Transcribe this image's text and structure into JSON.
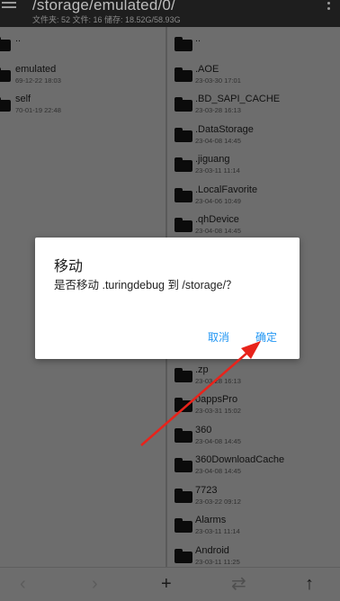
{
  "header": {
    "path": "/storage/emulated/0/",
    "stats": "文件夹: 52  文件: 16  储存: 18.52G/58.93G"
  },
  "left_pane": {
    "items": [
      {
        "name": "..",
        "date": ""
      },
      {
        "name": "emulated",
        "date": "69-12-22 18:03"
      },
      {
        "name": "self",
        "date": "70-01-19 22:48"
      }
    ]
  },
  "right_pane": {
    "items": [
      {
        "name": "..",
        "date": ""
      },
      {
        "name": ".AOE",
        "date": "23-03-30 17:01"
      },
      {
        "name": ".BD_SAPI_CACHE",
        "date": "23-03-28 16:13"
      },
      {
        "name": ".DataStorage",
        "date": "23-04-08 14:45"
      },
      {
        "name": ".jiguang",
        "date": "23-03-11 11:14"
      },
      {
        "name": ".LocalFavorite",
        "date": "23-04-06 10:49"
      },
      {
        "name": ".qhDevice",
        "date": "23-04-08 14:45"
      },
      {
        "name": ".zp",
        "date": "23-03-28 16:13"
      },
      {
        "name": "0appsPro",
        "date": "23-03-31 15:02"
      },
      {
        "name": "360",
        "date": "23-04-08 14:45"
      },
      {
        "name": "360DownloadCache",
        "date": "23-04-08 14:45"
      },
      {
        "name": "7723",
        "date": "23-03-22 09:12"
      },
      {
        "name": "Alarms",
        "date": "23-03-11 11:14"
      },
      {
        "name": "Android",
        "date": "23-03-11 11:25"
      }
    ]
  },
  "dialog": {
    "title": "移动",
    "message": "是否移动 .turingdebug 到 /storage/？",
    "cancel_label": "取消",
    "ok_label": "确定"
  },
  "bottom_bar": {
    "back_label": "‹",
    "forward_label": "›",
    "add_label": "+",
    "swap_label": "⇄",
    "up_label": "↑"
  },
  "colors": {
    "accent": "#2196f3",
    "annotation": "#e8231b"
  }
}
